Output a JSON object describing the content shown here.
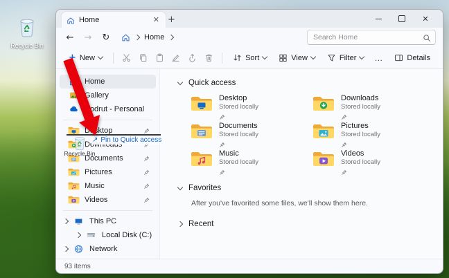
{
  "desktop": {
    "recycle_bin_label": "Recycle Bin"
  },
  "window": {
    "tab_title": "Home",
    "breadcrumb": {
      "location": "Home"
    },
    "search_placeholder": "Search Home",
    "toolbar": {
      "new": "New",
      "sort": "Sort",
      "view": "View",
      "filter": "Filter",
      "more": "…",
      "details": "Details"
    },
    "sidebar": {
      "items": [
        {
          "label": "Home"
        },
        {
          "label": "Gallery"
        },
        {
          "label": "Codrut - Personal"
        },
        {
          "label": "Desktop"
        },
        {
          "label": "Downloads"
        },
        {
          "label": "Documents"
        },
        {
          "label": "Pictures"
        },
        {
          "label": "Music"
        },
        {
          "label": "Videos"
        },
        {
          "label": "This PC"
        },
        {
          "label": "Local Disk (C:)"
        },
        {
          "label": "Network"
        }
      ]
    },
    "main": {
      "sections": {
        "quick_access": "Quick access",
        "favorites": "Favorites",
        "recent": "Recent"
      },
      "favorites_empty": "After you've favorited some files, we'll show them here.",
      "quick_access_items": [
        {
          "name": "Desktop",
          "detail": "Stored locally"
        },
        {
          "name": "Downloads",
          "detail": "Stored locally"
        },
        {
          "name": "Documents",
          "detail": "Stored locally"
        },
        {
          "name": "Pictures",
          "detail": "Stored locally"
        },
        {
          "name": "Music",
          "detail": "Stored locally"
        },
        {
          "name": "Videos",
          "detail": "Stored locally"
        }
      ]
    },
    "status": "93 items"
  },
  "drag": {
    "tooltip": "Pin to Quick access",
    "ghost_label": "Recycle Bin"
  },
  "annotation": {
    "arrow_color": "#e8000d"
  },
  "icon_colors": {
    "folder_front": "#ffd765",
    "folder_back": "#efa83a",
    "desktop": "#1669c9",
    "downloads": "#27a457",
    "documents": "#6d9bd8",
    "pictures": "#2fb2d6",
    "music": "#d6476b",
    "videos": "#8655d4",
    "onedrive": "#0a64c8",
    "network": "#2f7dd2",
    "pin": "#6f7277",
    "recycle_arrows": "#2e9e4f",
    "home_icon": "#3a72c8",
    "gallery_frame": "#e8b33c",
    "gallery_hill": "#2f7d32",
    "toolbar_disabled": "#9a9da1",
    "toolbar_icon": "#45484c",
    "accent": "#1266c9"
  }
}
